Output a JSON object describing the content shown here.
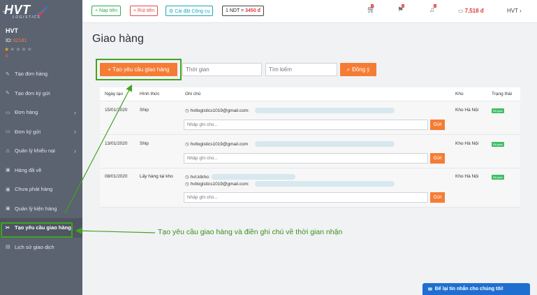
{
  "brand": {
    "name": "HVT",
    "sub": "LOGISTICS"
  },
  "user": {
    "name": "HVT",
    "id_label": "ID:",
    "id_value": "02181",
    "rating": 1,
    "max_rating": 5,
    "points": "0"
  },
  "menu": [
    {
      "label": "Tạo đơn hàng",
      "icon": "edit-icon",
      "glyph": "✎",
      "chevron": false
    },
    {
      "label": "Tạo đơn ký gửi",
      "icon": "edit-icon",
      "glyph": "✎",
      "chevron": false
    },
    {
      "label": "Đơn hàng",
      "icon": "list-icon",
      "glyph": "▭",
      "chevron": true
    },
    {
      "label": "Đơn ký gửi",
      "icon": "list-icon",
      "glyph": "▭",
      "chevron": true
    },
    {
      "label": "Quản lý khiếu nại",
      "icon": "warning-icon",
      "glyph": "⚠",
      "chevron": true
    },
    {
      "label": "Hàng đã về",
      "icon": "box-icon",
      "glyph": "▣",
      "chevron": false
    },
    {
      "label": "Chưa phát hàng",
      "icon": "box-icon",
      "glyph": "▣",
      "chevron": false
    },
    {
      "label": "Quản lý kiện hàng",
      "icon": "package-icon",
      "glyph": "▣",
      "chevron": false
    },
    {
      "label": "Tạo yêu cầu giao hàng",
      "icon": "truck-icon",
      "glyph": "✂",
      "chevron": false,
      "active": true
    },
    {
      "label": "Lịch sử giao dịch",
      "icon": "history-icon",
      "glyph": "▤",
      "chevron": false
    }
  ],
  "topbar": {
    "deposit": "+ Nạp tiền",
    "withdraw": "+ Rút tiền",
    "install_tool": "⚙ Cài đặt Công cụ",
    "rate_label": "1 NDT =",
    "rate_value": "3450 đ",
    "cart_badge": "0",
    "gift_badge": "0",
    "bell_badge": "0",
    "balance": "7,518 đ",
    "account": "HVT"
  },
  "page": {
    "title": "Giao hàng",
    "create_button": "+ Tạo yêu cầu giao hàng",
    "time_placeholder": "Thời gian",
    "search_placeholder": "Tìm kiếm",
    "agree_button": "Đồng ý"
  },
  "table": {
    "headers": {
      "date": "Ngày tạo",
      "form": "Hình thức",
      "note": "Ghi chú",
      "warehouse": "Kho",
      "status": "Trạng thái"
    },
    "rows": [
      {
        "date": "15/01/2020",
        "form": "Ship",
        "contact": "hvtlogistics1019@gmail.com:",
        "note_placeholder": "Nhập ghi chú...",
        "send": "Gửi",
        "warehouse": "Kho Hà Nội",
        "status": "Đã giao"
      },
      {
        "date": "13/01/2020",
        "form": "Ship",
        "contact": "hvtlogistics1019@gmail.com",
        "note_placeholder": "Nhập ghi chú...",
        "send": "Gửi",
        "warehouse": "Kho Hà Nội",
        "status": "Đã giao"
      },
      {
        "date": "08/01/2020",
        "form": "Lấy hàng tại kho",
        "contact": "hvt.ktkho:",
        "contact2": "hvtlogistics1019@gmail.com:",
        "note_placeholder": "Nhập ghi chú...",
        "send": "Gửi",
        "warehouse": "Kho Hà Nội",
        "status": "Đã giao"
      }
    ]
  },
  "annotation": "Tạo yêu cầu giao hàng và điền ghi chú về thời gian nhận",
  "chat_button": "Để lại tin nhắn cho chúng tôi!",
  "colors": {
    "sidebar": "#5b6270",
    "accent": "#f57c35",
    "highlight": "#3fa51f",
    "status": "#3cbf63"
  }
}
